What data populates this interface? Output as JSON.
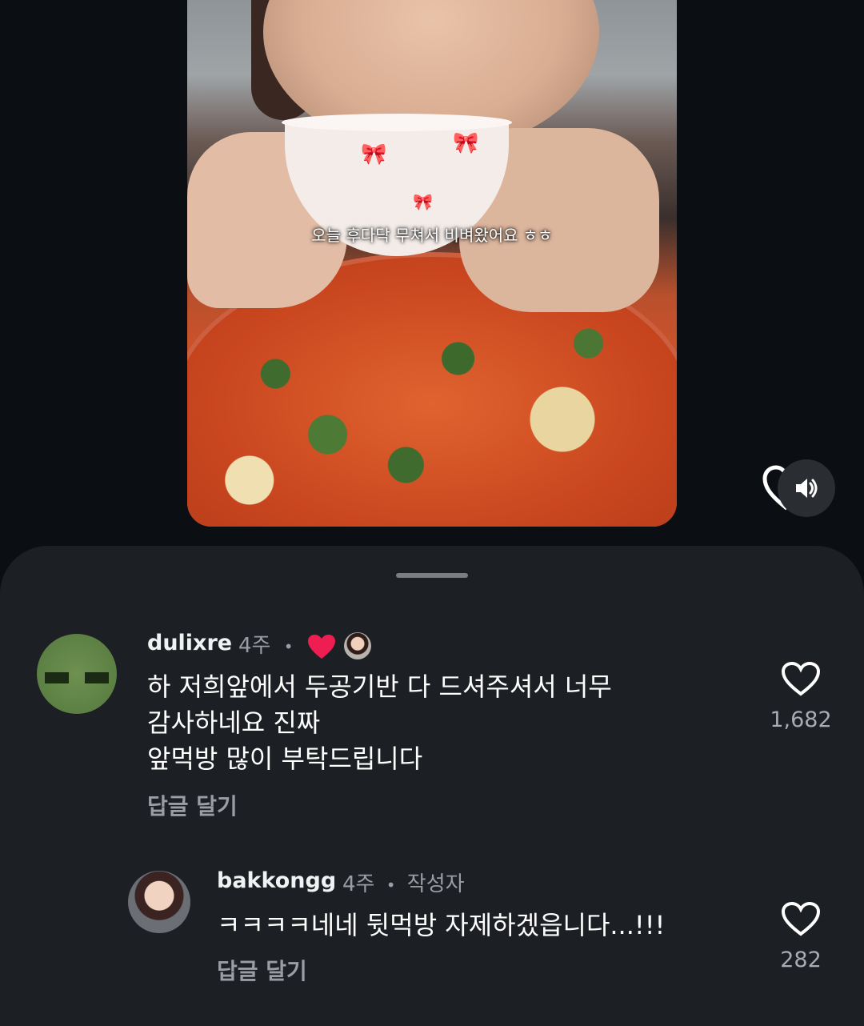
{
  "video": {
    "caption": "오늘 후다닥 무쳐서 비벼왔어요 ㅎㅎ",
    "sound_icon": "volume-icon"
  },
  "comments": [
    {
      "username": "dulixre",
      "time": "4주",
      "dot": "•",
      "text": "하 저희앞에서 두공기반 다 드셔주셔서 너무\n감사하네요 진짜\n앞먹방 많이 부탁드립니다",
      "reply_label": "답글 달기",
      "like_count": "1,682",
      "liked_by_creator": true
    },
    {
      "username": "bakkongg",
      "time": "4주",
      "dot": "•",
      "author_badge": "작성자",
      "text": "ㅋㅋㅋㅋ네네 뒷먹방 자제하겠읍니다...!!!",
      "reply_label": "답글 달기",
      "like_count": "282"
    }
  ],
  "colors": {
    "background": "#0b0e12",
    "sheet": "#1c1f23",
    "liked_heart": "#ee1d52",
    "muted_text": "#9a9ea4"
  }
}
